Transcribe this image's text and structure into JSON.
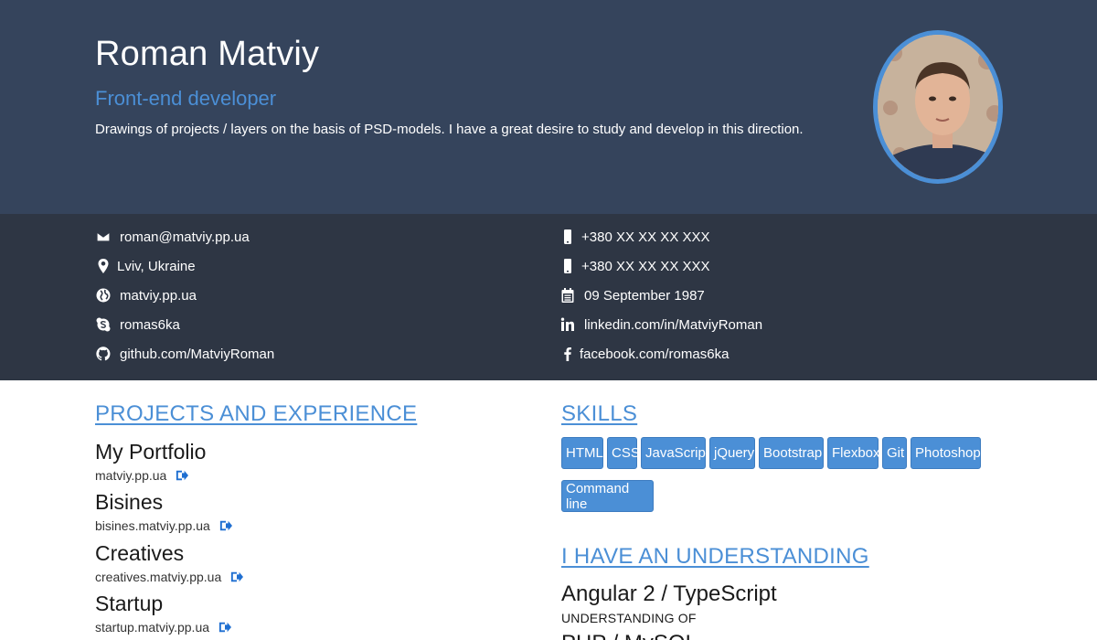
{
  "header": {
    "name": "Roman Matviy",
    "role": "Front-end developer",
    "summary": "Drawings of projects / layers on the basis of PSD-models. I have a great desire to study and develop in this direction."
  },
  "contacts": {
    "left": [
      {
        "icon": "envelope-icon",
        "text": "roman@matviy.pp.ua"
      },
      {
        "icon": "map-marker-icon",
        "text": "Lviv, Ukraine"
      },
      {
        "icon": "globe-icon",
        "text": "matviy.pp.ua"
      },
      {
        "icon": "skype-icon",
        "text": "romas6ka"
      },
      {
        "icon": "github-icon",
        "text": "github.com/MatviyRoman"
      }
    ],
    "right": [
      {
        "icon": "mobile-icon",
        "text": "+380 XX XX XX XXX"
      },
      {
        "icon": "mobile-icon",
        "text": "+380 XX XX XX XXX"
      },
      {
        "icon": "calendar-icon",
        "text": "09 September 1987"
      },
      {
        "icon": "linkedin-icon",
        "text": "linkedin.com/in/MatviyRoman"
      },
      {
        "icon": "facebook-icon",
        "text": "facebook.com/romas6ka"
      }
    ]
  },
  "projects": {
    "title": "PROJECTS AND EXPERIENCE",
    "items": [
      {
        "name": "My Portfolio",
        "url": "matviy.pp.ua"
      },
      {
        "name": "Bisines",
        "url": "bisines.matviy.pp.ua"
      },
      {
        "name": "Creatives",
        "url": "creatives.matviy.pp.ua"
      },
      {
        "name": "Startup",
        "url": "startup.matviy.pp.ua"
      }
    ]
  },
  "skills": {
    "title": "SKILLS",
    "items": [
      "HTML",
      "CSS",
      "JavaScript",
      "jQuery",
      "Bootstrap",
      "Flexbox",
      "Git",
      "Photoshop",
      "Command line"
    ]
  },
  "understanding": {
    "title": "I HAVE AN UNDERSTANDING",
    "items": [
      {
        "name": "Angular 2 / TypeScript",
        "level": "UNDERSTANDING OF"
      },
      {
        "name": "PHP / MySQL",
        "level": ""
      }
    ]
  },
  "colors": {
    "header_bg": "#35445c",
    "contacts_bg": "#2e3644",
    "accent": "#4b8fd6"
  }
}
